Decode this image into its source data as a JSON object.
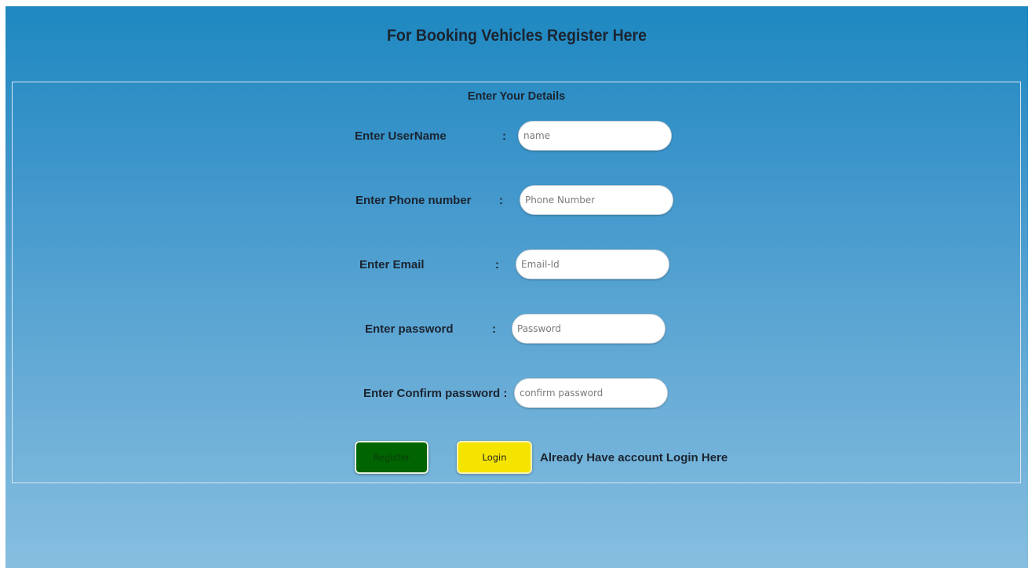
{
  "header": {
    "title": "For Booking Vehicles Register Here"
  },
  "form": {
    "legend": "Enter Your Details",
    "colon": ":",
    "fields": {
      "username": {
        "label": "Enter UserName",
        "placeholder": "name",
        "value": ""
      },
      "phone": {
        "label": "Enter Phone number",
        "placeholder": "Phone Number",
        "value": ""
      },
      "email": {
        "label": "Enter Email",
        "placeholder": "Email-Id",
        "value": ""
      },
      "password": {
        "label": "Enter password",
        "placeholder": "Password",
        "value": ""
      },
      "confirm_password": {
        "label": "Enter Confirm password :",
        "placeholder": "confirm password",
        "value": ""
      }
    },
    "register_label": "Register",
    "login_label": "Login",
    "login_prompt": "Already Have account Login Here"
  },
  "colors": {
    "background_top": "#1e88c0",
    "background_bottom": "#86bedf",
    "register_button": "#006400",
    "login_button": "#f5e400"
  }
}
